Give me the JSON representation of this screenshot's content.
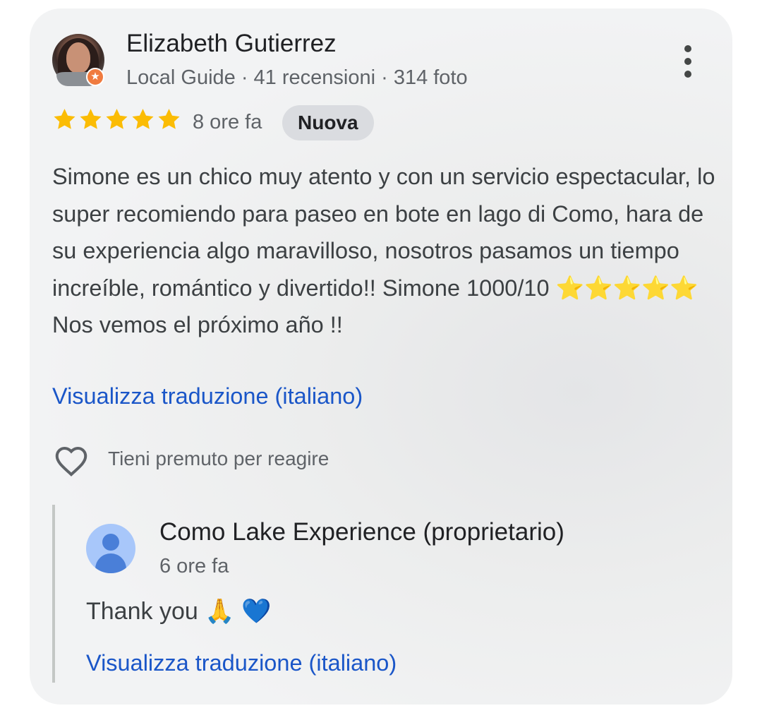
{
  "review": {
    "author_name": "Elizabeth Gutierrez",
    "author_meta": "Local Guide · 41 recensioni · 314 foto",
    "rating": 5,
    "rating_max": 5,
    "time": "8 ore fa",
    "badge": "Nuova",
    "text": "Simone es un chico muy atento y con un servicio espectacular, lo super recomiendo para paseo en bote en lago di Como, hara de su experiencia algo maravilloso, nosotros pasamos un tiempo increíble, romántico y divertido!! Simone 1000/10 ⭐⭐⭐⭐⭐ Nos vemos el próximo año !!",
    "translate_link": "Visualizza traduzione (italiano)",
    "react_hint": "Tieni premuto per reagire",
    "star_color": "#fbbc04"
  },
  "owner_reply": {
    "name": "Como Lake Experience (proprietario)",
    "time": "6 ore fa",
    "text": "Thank you 🙏 💙",
    "translate_link": "Visualizza traduzione (italiano)"
  },
  "icons": {
    "more": "more-vert-icon",
    "heart": "heart-outline-icon",
    "guide": "local-guide-star-icon"
  },
  "colors": {
    "link": "#1a56c8",
    "text_primary": "#202124",
    "text_secondary": "#5f6368",
    "badge_bg": "#dadce0"
  }
}
